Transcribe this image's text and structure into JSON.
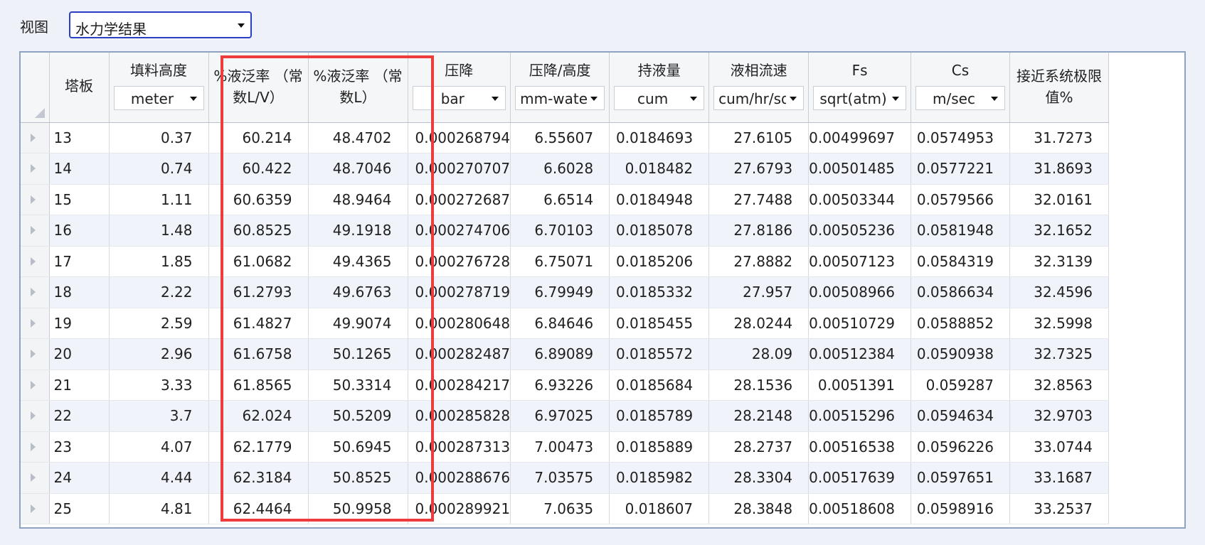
{
  "toolbar": {
    "view_label": "视图",
    "view_value": "水力学结果"
  },
  "columns": [
    {
      "key": "packing_height",
      "title": "填料高度",
      "unit": "meter"
    },
    {
      "key": "flood_lv",
      "title": "%液泛率 （常数L/V）",
      "title_lines": [
        "%液泛率 （常",
        "数L/V）"
      ]
    },
    {
      "key": "flood_l",
      "title": "%液泛率 （常数L）",
      "title_lines": [
        "%液泛率 （常",
        "数L）"
      ]
    },
    {
      "key": "dp",
      "title": "压降",
      "unit": "bar"
    },
    {
      "key": "dp_h",
      "title": "压降/高度",
      "unit": "mm-water"
    },
    {
      "key": "holdup",
      "title": "持液量",
      "unit": "cum"
    },
    {
      "key": "liq_vel",
      "title": "液相流速",
      "unit": "cum/hr/sq"
    },
    {
      "key": "fs",
      "title": "Fs",
      "unit": "sqrt(atm)"
    },
    {
      "key": "cs",
      "title": "Cs",
      "unit": "m/sec"
    },
    {
      "key": "approach",
      "title": "接近系统极限值%",
      "title_lines": [
        "接近系统极限",
        "值%"
      ]
    }
  ],
  "stage_header": "塔板",
  "rows": [
    [
      "13",
      "0.37",
      "60.214",
      "48.4702",
      "0.000268794",
      "6.55607",
      "0.0184693",
      "27.6105",
      "0.00499697",
      "0.0574953",
      "31.7273"
    ],
    [
      "14",
      "0.74",
      "60.422",
      "48.7046",
      "0.000270707",
      "6.6028",
      "0.018482",
      "27.6793",
      "0.00501485",
      "0.0577221",
      "31.8693"
    ],
    [
      "15",
      "1.11",
      "60.6359",
      "48.9464",
      "0.000272687",
      "6.6514",
      "0.0184948",
      "27.7488",
      "0.00503344",
      "0.0579566",
      "32.0161"
    ],
    [
      "16",
      "1.48",
      "60.8525",
      "49.1918",
      "0.000274706",
      "6.70103",
      "0.0185078",
      "27.8186",
      "0.00505236",
      "0.0581948",
      "32.1652"
    ],
    [
      "17",
      "1.85",
      "61.0682",
      "49.4365",
      "0.000276728",
      "6.75071",
      "0.0185206",
      "27.8882",
      "0.00507123",
      "0.0584319",
      "32.3139"
    ],
    [
      "18",
      "2.22",
      "61.2793",
      "49.6763",
      "0.000278719",
      "6.79949",
      "0.0185332",
      "27.957",
      "0.00508966",
      "0.0586634",
      "32.4596"
    ],
    [
      "19",
      "2.59",
      "61.4827",
      "49.9074",
      "0.000280648",
      "6.84646",
      "0.0185455",
      "28.0244",
      "0.00510729",
      "0.0588852",
      "32.5998"
    ],
    [
      "20",
      "2.96",
      "61.6758",
      "50.1265",
      "0.000282487",
      "6.89089",
      "0.0185572",
      "28.09",
      "0.00512384",
      "0.0590938",
      "32.7325"
    ],
    [
      "21",
      "3.33",
      "61.8565",
      "50.3314",
      "0.000284217",
      "6.93226",
      "0.0185684",
      "28.1536",
      "0.0051391",
      "0.059287",
      "32.8563"
    ],
    [
      "22",
      "3.7",
      "62.024",
      "50.5209",
      "0.000285828",
      "6.97025",
      "0.0185789",
      "28.2148",
      "0.00515296",
      "0.0594634",
      "32.9703"
    ],
    [
      "23",
      "4.07",
      "62.1779",
      "50.6945",
      "0.000287313",
      "7.00473",
      "0.0185889",
      "28.2737",
      "0.00516538",
      "0.0596226",
      "33.0744"
    ],
    [
      "24",
      "4.44",
      "62.3184",
      "50.8525",
      "0.000288676",
      "7.03575",
      "0.0185982",
      "28.3304",
      "0.00517639",
      "0.0597651",
      "33.1687"
    ],
    [
      "25",
      "4.81",
      "62.4464",
      "50.9958",
      "0.000289921",
      "7.0635",
      "0.018607",
      "28.3848",
      "0.00518608",
      "0.0598916",
      "33.2537"
    ]
  ],
  "colors": {
    "highlight": "#ee3b3b",
    "select_border": "#2b3fc4",
    "grid_border": "#8ea3bf"
  }
}
